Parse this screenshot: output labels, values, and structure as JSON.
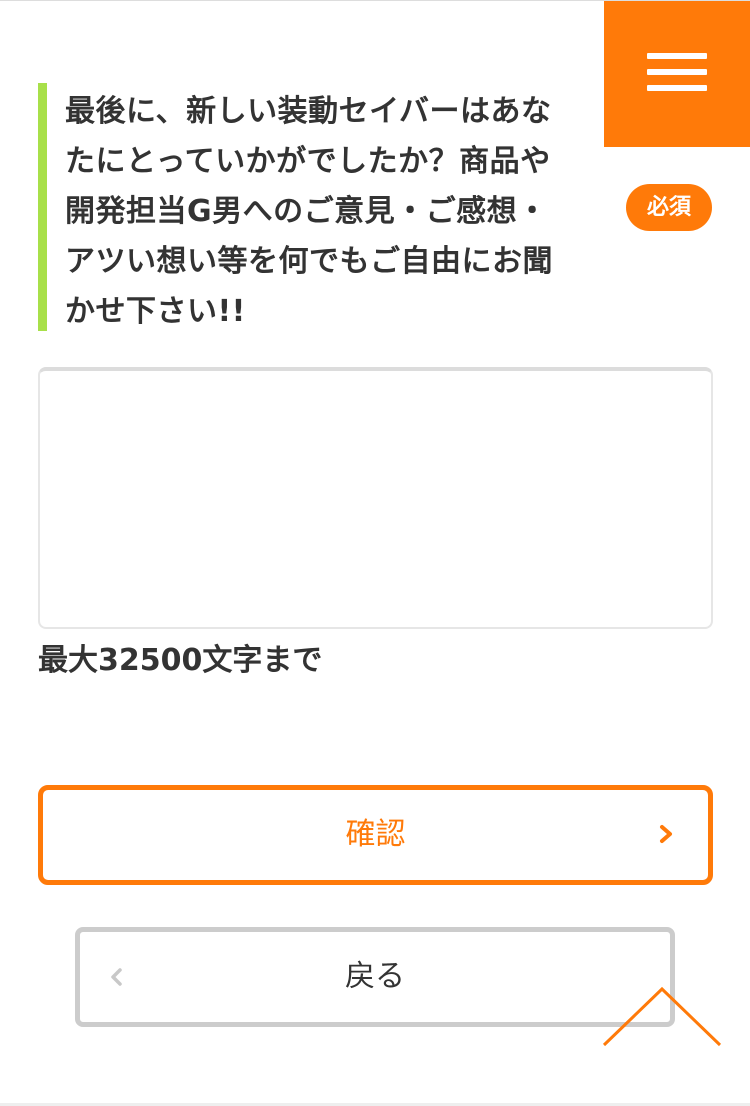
{
  "header": {
    "menu_icon": "hamburger-menu-icon",
    "accent_color": "#ff7a09"
  },
  "question": {
    "text": "最後に、新しい装動セイバーはあなたにとっていかがでしたか？商品や開発担当G男へのご意見・ご感想・アツい想い等を何でもご自由にお聞かせ下さい!!",
    "lines": [
      "最後に、新しい装動セイバーはあな",
      "たにとっていかがでしたか？商品や",
      "開発担当G男へのご意見・ご感想・",
      "アツい想い等を何でもご自由にお聞",
      "かせ下さい!!"
    ],
    "required_label": "必須",
    "accent_bar_color": "#a8e04a"
  },
  "answer": {
    "value": "",
    "placeholder": "",
    "limit_text": "最大32500文字まで"
  },
  "buttons": {
    "confirm_label": "確認",
    "confirm_icon": "chevron-right-icon",
    "back_label": "戻る",
    "back_icon": "chevron-left-icon"
  },
  "scroll_top": {
    "icon": "chevron-up-icon"
  }
}
